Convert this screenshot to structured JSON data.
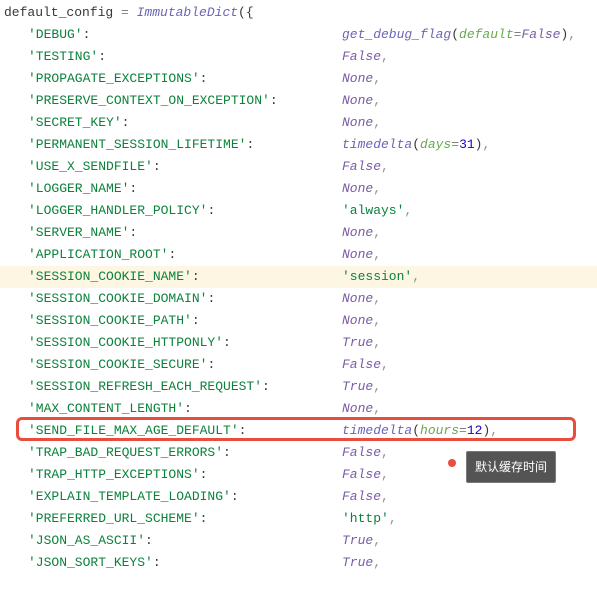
{
  "header": {
    "var": "default_config",
    "op": " = ",
    "func": "ImmutableDict",
    "paren": "({"
  },
  "rows": [
    {
      "key": "'DEBUG'",
      "valueType": "call",
      "func": "get_debug_flag",
      "arg": "default",
      "argVal": "False"
    },
    {
      "key": "'TESTING'",
      "valueType": "false",
      "text": "False"
    },
    {
      "key": "'PROPAGATE_EXCEPTIONS'",
      "valueType": "none",
      "text": "None"
    },
    {
      "key": "'PRESERVE_CONTEXT_ON_EXCEPTION'",
      "valueType": "none",
      "text": "None"
    },
    {
      "key": "'SECRET_KEY'",
      "valueType": "none",
      "text": "None"
    },
    {
      "key": "'PERMANENT_SESSION_LIFETIME'",
      "valueType": "timedelta",
      "func": "timedelta",
      "arg": "days",
      "argVal": "31"
    },
    {
      "key": "'USE_X_SENDFILE'",
      "valueType": "false",
      "text": "False"
    },
    {
      "key": "'LOGGER_NAME'",
      "valueType": "none",
      "text": "None"
    },
    {
      "key": "'LOGGER_HANDLER_POLICY'",
      "valueType": "str",
      "text": "'always'"
    },
    {
      "key": "'SERVER_NAME'",
      "valueType": "none",
      "text": "None"
    },
    {
      "key": "'APPLICATION_ROOT'",
      "valueType": "none",
      "text": "None"
    },
    {
      "key": "'SESSION_COOKIE_NAME'",
      "valueType": "str",
      "text": "'session'",
      "highlighted": true
    },
    {
      "key": "'SESSION_COOKIE_DOMAIN'",
      "valueType": "none",
      "text": "None"
    },
    {
      "key": "'SESSION_COOKIE_PATH'",
      "valueType": "none",
      "text": "None"
    },
    {
      "key": "'SESSION_COOKIE_HTTPONLY'",
      "valueType": "true",
      "text": "True"
    },
    {
      "key": "'SESSION_COOKIE_SECURE'",
      "valueType": "false",
      "text": "False"
    },
    {
      "key": "'SESSION_REFRESH_EACH_REQUEST'",
      "valueType": "true",
      "text": "True"
    },
    {
      "key": "'MAX_CONTENT_LENGTH'",
      "valueType": "none",
      "text": "None"
    },
    {
      "key": "'SEND_FILE_MAX_AGE_DEFAULT'",
      "valueType": "timedelta",
      "func": "timedelta",
      "arg": "hours",
      "argVal": "12",
      "boxed": true
    },
    {
      "key": "'TRAP_BAD_REQUEST_ERRORS'",
      "valueType": "false",
      "text": "False"
    },
    {
      "key": "'TRAP_HTTP_EXCEPTIONS'",
      "valueType": "false",
      "text": "False"
    },
    {
      "key": "'EXPLAIN_TEMPLATE_LOADING'",
      "valueType": "false",
      "text": "False"
    },
    {
      "key": "'PREFERRED_URL_SCHEME'",
      "valueType": "str",
      "text": "'http'"
    },
    {
      "key": "'JSON_AS_ASCII'",
      "valueType": "true",
      "text": "True"
    },
    {
      "key": "'JSON_SORT_KEYS'",
      "valueType": "true",
      "text": "True"
    }
  ],
  "tooltip": "默认缓存时间",
  "comma": ","
}
